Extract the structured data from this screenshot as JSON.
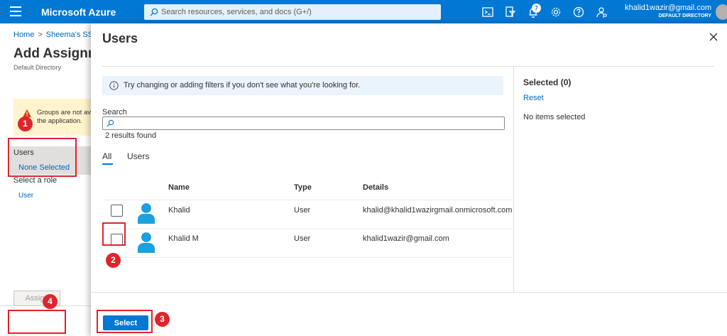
{
  "topbar": {
    "brand": "Microsoft Azure",
    "search_placeholder": "Search resources, services, and docs (G+/)",
    "notification_count": "7",
    "account_email": "khalid1wazir@gmail.com",
    "account_directory": "DEFAULT DIRECTORY",
    "icons": [
      "cloud-shell-icon",
      "directory-filter-icon",
      "notifications-icon",
      "settings-icon",
      "help-icon",
      "feedback-icon"
    ],
    "accent_color": "#0078d4"
  },
  "background_page": {
    "breadcrumb": [
      "Home",
      "Sheema's SS"
    ],
    "title": "Add Assignm",
    "subtitle": "Default Directory",
    "warning_text": "Groups are not av the application.",
    "users_label": "Users",
    "users_value": "None Selected",
    "role_label": "Select a role",
    "role_value": "User",
    "assign_label": "Assign"
  },
  "panel": {
    "title": "Users",
    "info_text": "Try changing or adding filters if you don't see what you're looking for.",
    "search_label": "Search",
    "search_value": "",
    "results_text": "2 results found",
    "tabs": [
      "All",
      "Users"
    ],
    "columns": [
      "Name",
      "Type",
      "Details"
    ],
    "rows": [
      {
        "name": "Khalid",
        "type": "User",
        "details": "khalid@khalid1wazirgmail.onmicrosoft.com"
      },
      {
        "name": "Khalid M",
        "type": "User",
        "details": "khalid1wazir@gmail.com"
      }
    ],
    "selected_title": "Selected (0)",
    "reset_label": "Reset",
    "no_items_text": "No items selected",
    "select_label": "Select"
  },
  "annotations": [
    "1",
    "2",
    "3",
    "4"
  ]
}
